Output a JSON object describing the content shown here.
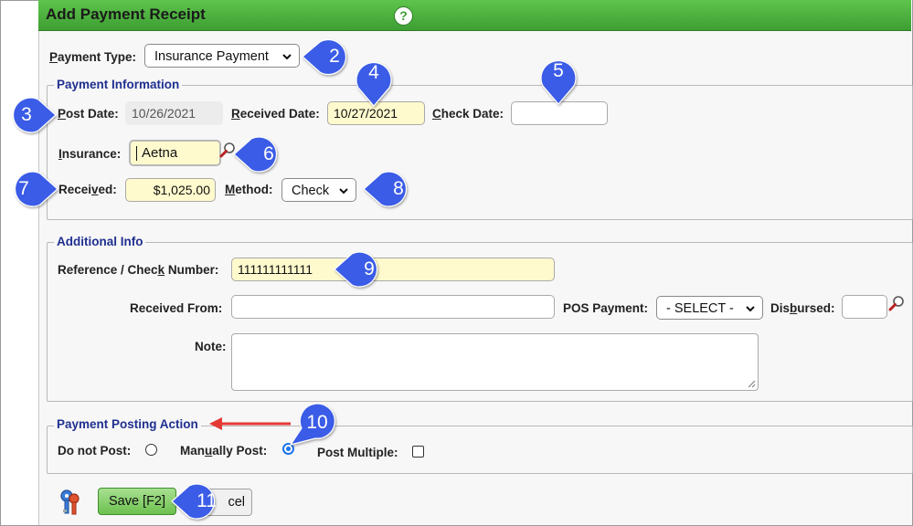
{
  "header": {
    "title": "Add Payment Receipt",
    "help_glyph": "?"
  },
  "payment_type": {
    "label_first": "P",
    "label_rest": "ayment Type:",
    "value": "Insurance Payment"
  },
  "payment_information": {
    "legend": "Payment Information",
    "post_date_label_first": "P",
    "post_date_label_rest": "ost Date:",
    "post_date_value": "10/26/2021",
    "received_date_label_first": "R",
    "received_date_label_rest": "eceived Date:",
    "received_date_value": "10/27/2021",
    "check_date_label_first": "C",
    "check_date_label_rest": "heck Date:",
    "check_date_value": "",
    "insurance_label_first": "I",
    "insurance_label_rest": "nsurance:",
    "insurance_value": "Aetna",
    "received_label_a": "Recei",
    "received_label_u": "v",
    "received_label_b": "ed:",
    "received_value": "$1,025.00",
    "method_label_first": "M",
    "method_label_rest": "ethod:",
    "method_value": "Check"
  },
  "additional_info": {
    "legend": "Additional Info",
    "reference_label_a": "Reference / Chec",
    "reference_label_u": "k",
    "reference_label_b": " Number:",
    "reference_value": "111111111111",
    "received_from_label": "Received From:",
    "received_from_value": "",
    "pos_payment_label": "POS Payment:",
    "pos_payment_value": "- SELECT -",
    "disbursed_label_a": "Dis",
    "disbursed_label_u": "b",
    "disbursed_label_b": "ursed:",
    "disbursed_value": "",
    "note_label": "Note:",
    "note_value": ""
  },
  "posting_action": {
    "legend": "Payment Posting Action",
    "do_not_post_label": "Do not Post:",
    "manually_post_label_a": "Man",
    "manually_post_label_u": "u",
    "manually_post_label_b": "ally Post:",
    "post_multiple_label": "Post Multiple:",
    "selected": "manually_post"
  },
  "footer": {
    "save_label": "Save [F2]",
    "cancel_label_visible": "cel"
  },
  "callouts": [
    "2",
    "3",
    "4",
    "5",
    "6",
    "7",
    "8",
    "9",
    "10",
    "11"
  ],
  "colors": {
    "title_bar": "#4caf3f",
    "callout": "#3a5ce6",
    "legend_text": "#1f2f8f",
    "highlight_field": "#fffacd",
    "arrow": "#e53935"
  }
}
